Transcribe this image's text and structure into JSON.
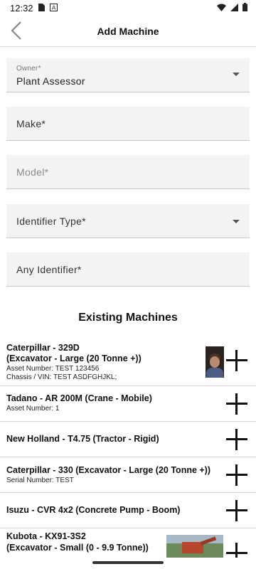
{
  "status_bar": {
    "time": "12:32",
    "left_icons": [
      "sim-card-icon",
      "a-box-icon"
    ],
    "right_icons": [
      "wifi-icon",
      "signal-icon",
      "battery-icon"
    ]
  },
  "header": {
    "title": "Add Machine",
    "back_icon": "chevron-left-icon"
  },
  "form": {
    "owner": {
      "label": "Owner*",
      "value": "Plant Assessor"
    },
    "make": {
      "placeholder": "Make*"
    },
    "model": {
      "placeholder": "Model*"
    },
    "identifier_type": {
      "placeholder": "Identifier Type*"
    },
    "any_identifier": {
      "placeholder": "Any Identifier*"
    }
  },
  "existing": {
    "title": "Existing Machines",
    "machines": [
      {
        "line1": "Caterpillar - 329D",
        "line2": "(Excavator - Large (20 Tonne +))",
        "details": [
          "Asset Number: TEST 123456",
          "Chassis / VIN: TEST ASDFGHJKL;"
        ],
        "has_photo": true
      },
      {
        "line1": "Tadano - AR 200M (Crane - Mobile)",
        "details": [
          "Asset Number: 1"
        ],
        "has_photo": false
      },
      {
        "line1": "New Holland - T4.75 (Tractor - Rigid)",
        "details": [],
        "has_photo": false
      },
      {
        "line1": "Caterpillar - 330 (Excavator - Large (20 Tonne +))",
        "details": [
          "Serial Number: TEST"
        ],
        "has_photo": false
      },
      {
        "line1": "Isuzu - CVR 4x2 (Concrete Pump - Boom)",
        "details": [],
        "has_photo": false
      },
      {
        "line1": "Kubota - KX91-3S2",
        "line2": "(Excavator - Small (0 - 9.9 Tonne))",
        "details": [],
        "has_photo": true
      }
    ]
  }
}
